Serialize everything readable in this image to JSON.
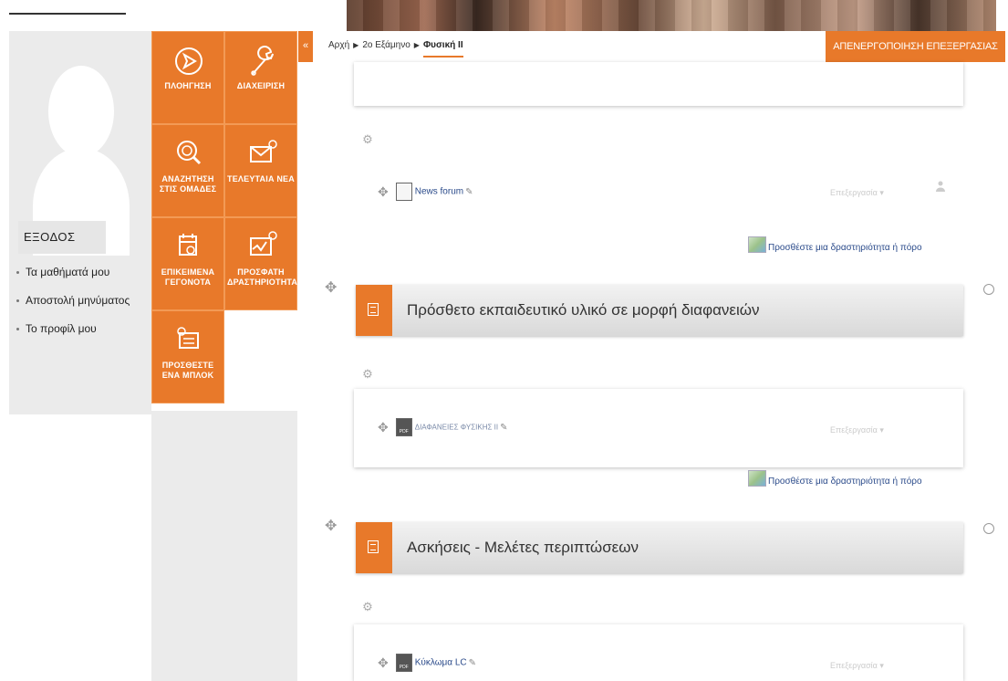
{
  "header": {
    "collapse_icon": "double-chevron-left-icon",
    "edit_mode_label": "ΑΠΕΝΕΡΓΟΠΟΙΗΣΗ ΕΠΕΞΕΡΓΑΣΙΑΣ"
  },
  "breadcrumb": {
    "items": [
      "Αρχή",
      "2ο Εξάμηνο",
      "Φυσική ΙΙ"
    ]
  },
  "user_panel": {
    "logout_label": "ΕΞΟΔΟΣ",
    "links": [
      "Τα μαθήματά μου",
      "Αποστολή μηνύματος",
      "Το προφίλ μου"
    ]
  },
  "tiles": [
    {
      "label": "ΠΛΟΗΓΗΣΗ",
      "icon": "navigation-icon"
    },
    {
      "label": "ΔΙΑΧΕΙΡΙΣΗ",
      "icon": "wrench-icon"
    },
    {
      "label": "ΑΝΑΖΗΤΗΣΗ ΣΤΙΣ ΟΜΑΔΕΣ",
      "icon": "search-icon"
    },
    {
      "label": "ΤΕΛΕΥΤΑΙΑ ΝΕΑ",
      "icon": "news-mail-icon"
    },
    {
      "label": "ΕΠΙΚΕΙΜΕΝΑ ΓΕΓΟΝΟΤΑ",
      "icon": "calendar-icon"
    },
    {
      "label": "ΠΡΟΣΦΑΤΗ ΔΡΑΣΤΗΡΙΟΤΗΤΑ",
      "icon": "activity-chart-icon"
    },
    {
      "label": "ΠΡΟΣΘΕΣΤΕ ΕΝΑ ΜΠΛΟΚ",
      "icon": "add-block-icon"
    }
  ],
  "course": {
    "activities": [
      {
        "name": "News forum",
        "icon": "forum-icon",
        "edit_label": "Επεξεργασία"
      },
      {
        "name": "ΔΙΑΦΑΝΕΙΕΣ ΦΥΣΙΚΗΣ ΙΙ",
        "icon": "pdf-icon",
        "edit_label": "Επεξεργασία"
      },
      {
        "name": "Κύκλωμα LC",
        "icon": "pdf-icon",
        "edit_label": "Επεξεργασία"
      }
    ],
    "add_activity_label": "Προσθέστε μια δραστηριότητα ή πόρο",
    "sections": [
      {
        "title": "Πρόσθετο εκπαιδευτικό υλικό σε μορφή διαφανειών"
      },
      {
        "title": "Ασκήσεις - Μελέτες περιπτώσεων"
      }
    ]
  },
  "colors": {
    "accent": "#e8792a",
    "panel_gray": "#ebebeb",
    "link_blue": "#2a4a8a"
  }
}
